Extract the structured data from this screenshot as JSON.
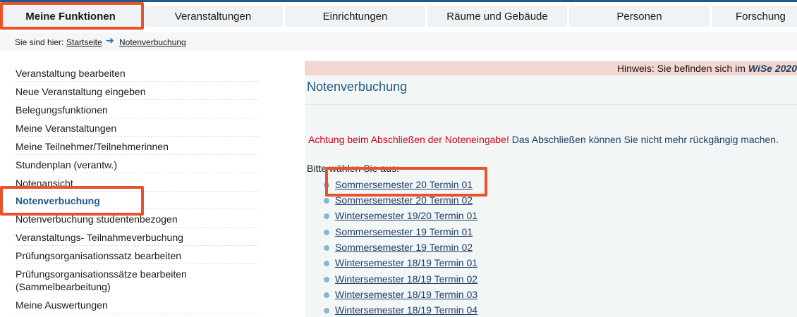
{
  "nav": {
    "tabs": [
      {
        "label": "Meine Funktionen"
      },
      {
        "label": "Veranstaltungen"
      },
      {
        "label": "Einrichtungen"
      },
      {
        "label": "Räume und Gebäude"
      },
      {
        "label": "Personen"
      },
      {
        "label": "Forschung"
      }
    ],
    "active_index": 0
  },
  "breadcrumb": {
    "prefix": "Sie sind hier:",
    "items": [
      "Startseite",
      "Notenverbuchung"
    ]
  },
  "sidebar": {
    "items": [
      {
        "label": "Veranstaltung bearbeiten"
      },
      {
        "label": "Neue Veranstaltung eingeben"
      },
      {
        "label": "Belegungsfunktionen"
      },
      {
        "label": "Meine Veranstaltungen"
      },
      {
        "label": "Meine Teilnehmer/Teilnehmerinnen"
      },
      {
        "label": "Stundenplan (verantw.)"
      },
      {
        "label": "Notenansicht"
      },
      {
        "label": "Notenverbuchung"
      },
      {
        "label": "Notenverbuchung studentenbezogen"
      },
      {
        "label": "Veranstaltungs- Teilnahmeverbuchung"
      },
      {
        "label": "Prüfungsorganisationssatz bearbeiten"
      },
      {
        "label": "Prüfungsorganisationssätze bearbeiten"
      },
      {
        "label": "(Sammelbearbeitung)"
      },
      {
        "label": "Meine Auswertungen"
      }
    ],
    "active_index": 7
  },
  "main": {
    "notice_text": "Hinweis: Sie befinden sich im",
    "notice_semester": "WiSe 2020",
    "title": "Notenverbuchung",
    "warning_red": "Achtung beim Abschließen der Noteneingabe!",
    "warning_rest": "Das Abschließen können Sie nicht mehr rückgängig machen.",
    "prompt": "Bitte wählen Sie aus:",
    "terms": [
      {
        "label": "Sommersemester 20 Termin 01"
      },
      {
        "label": "Sommersemester 20 Termin 02"
      },
      {
        "label": "Wintersemester 19/20 Termin 01"
      },
      {
        "label": "Sommersemester 19 Termin 01"
      },
      {
        "label": "Sommersemester 19 Termin 02"
      },
      {
        "label": "Wintersemester 18/19 Termin 01"
      },
      {
        "label": "Wintersemester 18/19 Termin 02"
      },
      {
        "label": "Wintersemester 18/19 Termin 03"
      },
      {
        "label": "Wintersemester 18/19 Termin 04"
      }
    ]
  },
  "colors": {
    "accent": "#1f5a8a",
    "highlight": "#e8532c",
    "warning": "#d0021b",
    "notice_bg": "#f2d6cf"
  }
}
